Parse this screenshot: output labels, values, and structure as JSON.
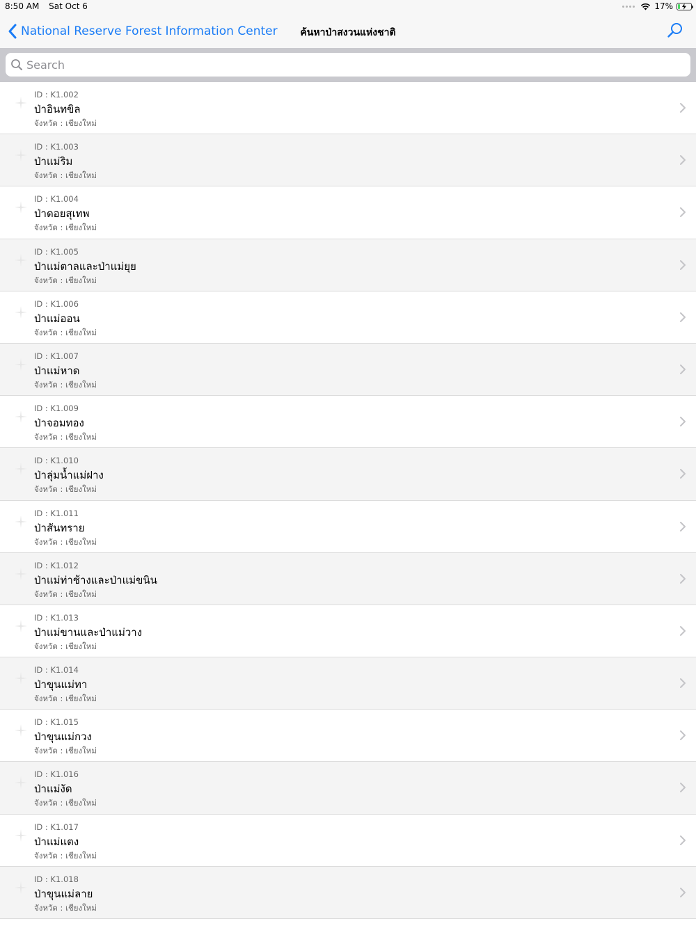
{
  "status_bar": {
    "time": "8:50 AM",
    "date": "Sat Oct 6",
    "battery_text": "17%",
    "battery_level": 0.17,
    "battery_color": "#4cd964"
  },
  "nav": {
    "back_label": "National Reserve Forest Information Center",
    "title": "ค้นหาป่าสงวนแห่งชาติ",
    "accent_color": "#1a7cf6",
    "icons": [
      "chevron-left-icon",
      "search-icon"
    ]
  },
  "search": {
    "placeholder": "Search",
    "value": ""
  },
  "forests": [
    {
      "id": "ID : K1.002",
      "name": "ป่าอินทขิล",
      "province": "จังหวัด : เชียงใหม่"
    },
    {
      "id": "ID : K1.003",
      "name": "ป่าแม่ริม",
      "province": "จังหวัด : เชียงใหม่"
    },
    {
      "id": "ID : K1.004",
      "name": "ป่าดอยสุเทพ",
      "province": "จังหวัด : เชียงใหม่"
    },
    {
      "id": "ID : K1.005",
      "name": "ป่าแม่ตาลและป่าแม่ยุย",
      "province": "จังหวัด : เชียงใหม่"
    },
    {
      "id": "ID : K1.006",
      "name": "ป่าแม่ออน",
      "province": "จังหวัด : เชียงใหม่"
    },
    {
      "id": "ID : K1.007",
      "name": "ป่าแม่หาด",
      "province": "จังหวัด : เชียงใหม่"
    },
    {
      "id": "ID : K1.009",
      "name": "ป่าจอมทอง",
      "province": "จังหวัด : เชียงใหม่"
    },
    {
      "id": "ID : K1.010",
      "name": "ป่าลุ่มน้ำแม่ฝาง",
      "province": "จังหวัด : เชียงใหม่"
    },
    {
      "id": "ID : K1.011",
      "name": "ป่าสันทราย",
      "province": "จังหวัด : เชียงใหม่"
    },
    {
      "id": "ID : K1.012",
      "name": "ป่าแม่ท่าช้างและป่าแม่ขนิน",
      "province": "จังหวัด : เชียงใหม่"
    },
    {
      "id": "ID : K1.013",
      "name": "ป่าแม่ขานและป่าแม่วาง",
      "province": "จังหวัด : เชียงใหม่"
    },
    {
      "id": "ID : K1.014",
      "name": "ป่าขุนแม่ทา",
      "province": "จังหวัด : เชียงใหม่"
    },
    {
      "id": "ID : K1.015",
      "name": "ป่าขุนแม่กวง",
      "province": "จังหวัด : เชียงใหม่"
    },
    {
      "id": "ID : K1.016",
      "name": "ป่าแม่งัด",
      "province": "จังหวัด : เชียงใหม่"
    },
    {
      "id": "ID : K1.017",
      "name": "ป่าแม่แตง",
      "province": "จังหวัด : เชียงใหม่"
    },
    {
      "id": "ID : K1.018",
      "name": "ป่าขุนแม่ลาย",
      "province": "จังหวัด : เชียงใหม่"
    }
  ]
}
